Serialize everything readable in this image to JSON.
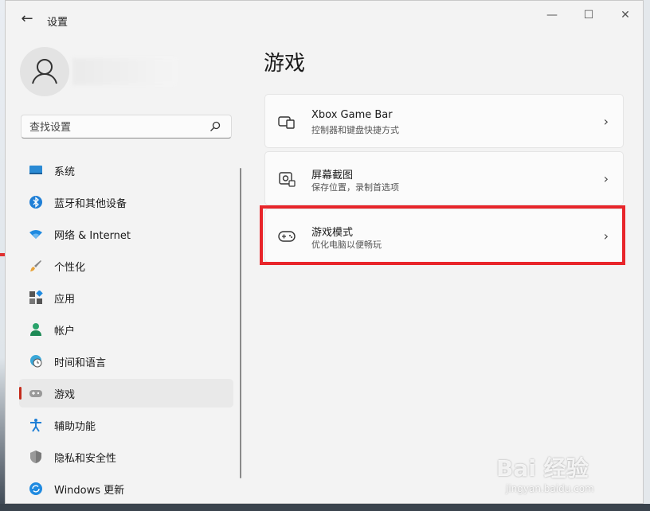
{
  "window": {
    "title": "设置",
    "back_glyph": "←",
    "minimize_glyph": "—",
    "maximize_glyph": "☐",
    "close_glyph": "✕"
  },
  "search": {
    "placeholder": "查找设置"
  },
  "sidebar": {
    "items": [
      {
        "label": "系统",
        "icon": "monitor-icon"
      },
      {
        "label": "蓝牙和其他设备",
        "icon": "bluetooth-icon"
      },
      {
        "label": "网络 & Internet",
        "icon": "wifi-icon"
      },
      {
        "label": "个性化",
        "icon": "brush-icon"
      },
      {
        "label": "应用",
        "icon": "apps-icon"
      },
      {
        "label": "帐户",
        "icon": "person-icon"
      },
      {
        "label": "时间和语言",
        "icon": "globe-clock-icon"
      },
      {
        "label": "游戏",
        "icon": "gamepad-icon",
        "selected": true
      },
      {
        "label": "辅助功能",
        "icon": "accessibility-icon"
      },
      {
        "label": "隐私和安全性",
        "icon": "shield-icon"
      },
      {
        "label": "Windows 更新",
        "icon": "update-icon"
      }
    ]
  },
  "main": {
    "title": "游戏",
    "cards": [
      {
        "title": "Xbox Game Bar",
        "subtitle": "控制器和键盘快捷方式",
        "icon": "game-bar-icon"
      },
      {
        "title": "屏幕截图",
        "subtitle": "保存位置，录制首选项",
        "icon": "capture-icon"
      },
      {
        "title": "游戏模式",
        "subtitle": "优化电脑以便畅玩",
        "icon": "gamepad-icon",
        "highlighted": true
      }
    ],
    "chevron": "›"
  },
  "watermark": {
    "brand": "Bai 经验",
    "url": "jingyan.baidu.com"
  },
  "colors": {
    "accent": "#c42b1c",
    "highlight_box": "#e8252a",
    "window_bg": "#f3f3f3",
    "card_bg": "#fbfbfb"
  }
}
